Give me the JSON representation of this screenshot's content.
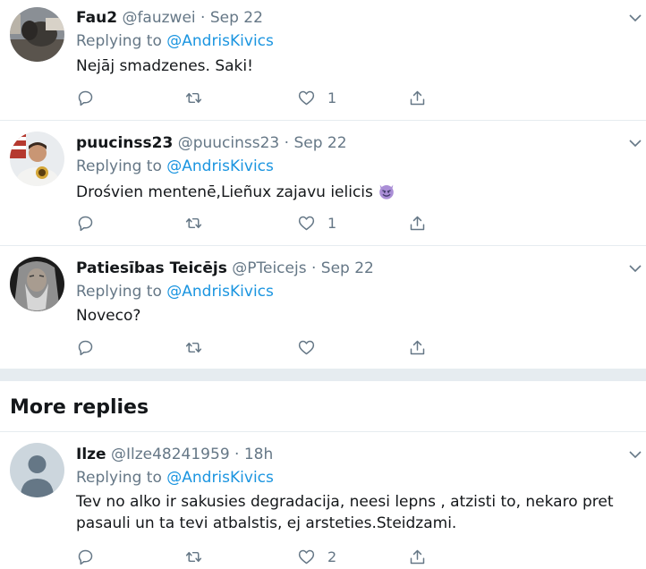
{
  "tweets": [
    {
      "display_name": "Fau2",
      "handle": "@fauzwei",
      "dot": "·",
      "time": "Sep 22",
      "replying_prefix": "Replying to",
      "replying_to": "@AndrisKivics",
      "text": "Nejāj smadzenes. Saki!",
      "reply_count": "",
      "retweet_count": "",
      "like_count": "1"
    },
    {
      "display_name": "puucinss23",
      "handle": "@puucinss23",
      "dot": "·",
      "time": "Sep 22",
      "replying_prefix": "Replying to",
      "replying_to": "@AndrisKivics",
      "text": "Drośvien mentenē,Lieñux zajavu ielicis",
      "emoji": "smiling-imp-emoji",
      "reply_count": "",
      "retweet_count": "",
      "like_count": "1"
    },
    {
      "display_name": "Patiesības Teicējs",
      "handle": "@PTeicejs",
      "dot": "·",
      "time": "Sep 22",
      "replying_prefix": "Replying to",
      "replying_to": "@AndrisKivics",
      "text": "Noveco?",
      "reply_count": "",
      "retweet_count": "",
      "like_count": ""
    }
  ],
  "more_replies": {
    "heading": "More replies",
    "tweets": [
      {
        "display_name": "Ilze",
        "handle": "@Ilze48241959",
        "dot": "·",
        "time": "18h",
        "replying_prefix": "Replying to",
        "replying_to": "@AndrisKivics",
        "text_line1": "Tev no alko ir sakusies degradacija, neesi lepns , atzisti to, nekaro pret",
        "text_line2": "pasauli un ta tevi atbalstis, ej arsteties.Steidzami.",
        "reply_count": "",
        "retweet_count": "",
        "like_count": "2"
      }
    ]
  },
  "colors": {
    "text": "#14171a",
    "secondary": "#657786",
    "link": "#1b95e0",
    "divider": "#e6ecf0"
  },
  "icons": [
    "reply-icon",
    "retweet-icon",
    "like-icon",
    "share-icon",
    "chevron-down-icon"
  ]
}
